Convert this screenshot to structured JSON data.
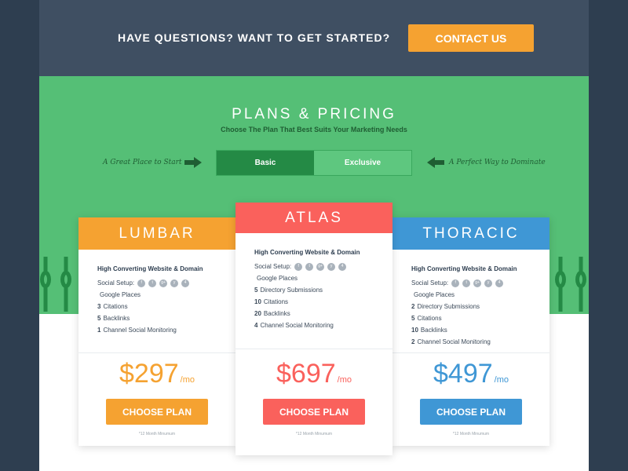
{
  "topbar": {
    "question": "HAVE QUESTIONS? WANT TO GET STARTED?",
    "contact_label": "CONTACT US"
  },
  "pricing": {
    "title": "PLANS & PRICING",
    "subtitle": "Choose The Plan That Best Suits Your Marketing Needs",
    "left_tagline": "A Great Place to Start",
    "right_tagline": "A Perfect Way to Dominate",
    "toggle": {
      "basic": "Basic",
      "exclusive": "Exclusive",
      "active": "Basic"
    }
  },
  "colors": {
    "orange": "#f5a231",
    "red": "#fa615c",
    "blue": "#3f97d5",
    "green": "#55bf76",
    "dark_green": "#248a45",
    "navy": "#3f4f62"
  },
  "plans": [
    {
      "name": "LUMBAR",
      "feature_title": "High Converting Website & Domain",
      "social_label": "Social Setup:",
      "features": [
        {
          "num": "",
          "text": "Google Places"
        },
        {
          "num": "3",
          "text": "Citations"
        },
        {
          "num": "5",
          "text": "Backlinks"
        },
        {
          "num": "1",
          "text": "Channel Social Monitoring"
        }
      ],
      "price": "$297",
      "unit": "/mo",
      "button": "CHOOSE PLAN",
      "minimum": "*12 Month Minumum"
    },
    {
      "name": "ATLAS",
      "feature_title": "High Converting Website & Domain",
      "social_label": "Social Setup:",
      "features": [
        {
          "num": "",
          "text": "Google Places"
        },
        {
          "num": "5",
          "text": "Directory Submissions"
        },
        {
          "num": "10",
          "text": "Citations"
        },
        {
          "num": "20",
          "text": "Backlinks"
        },
        {
          "num": "4",
          "text": "Channel Social Monitoring"
        }
      ],
      "price": "$697",
      "unit": "/mo",
      "button": "CHOOSE PLAN",
      "minimum": "*12 Month Minumum"
    },
    {
      "name": "THORACIC",
      "feature_title": "High Converting Website & Domain",
      "social_label": "Social Setup:",
      "features": [
        {
          "num": "",
          "text": "Google Places"
        },
        {
          "num": "2",
          "text": "Directory Submissions"
        },
        {
          "num": "5",
          "text": "Citations"
        },
        {
          "num": "10",
          "text": "Backlinks"
        },
        {
          "num": "2",
          "text": "Channel Social Monitoring"
        }
      ],
      "price": "$497",
      "unit": "/mo",
      "button": "CHOOSE PLAN",
      "minimum": "*12 Month Minumum"
    }
  ],
  "social_icons": [
    {
      "name": "facebook-icon",
      "glyph": "f"
    },
    {
      "name": "twitter-icon",
      "glyph": "t"
    },
    {
      "name": "google-plus-icon",
      "glyph": "g+"
    },
    {
      "name": "yelp-icon",
      "glyph": "y"
    },
    {
      "name": "foursquare-icon",
      "glyph": "4"
    }
  ]
}
